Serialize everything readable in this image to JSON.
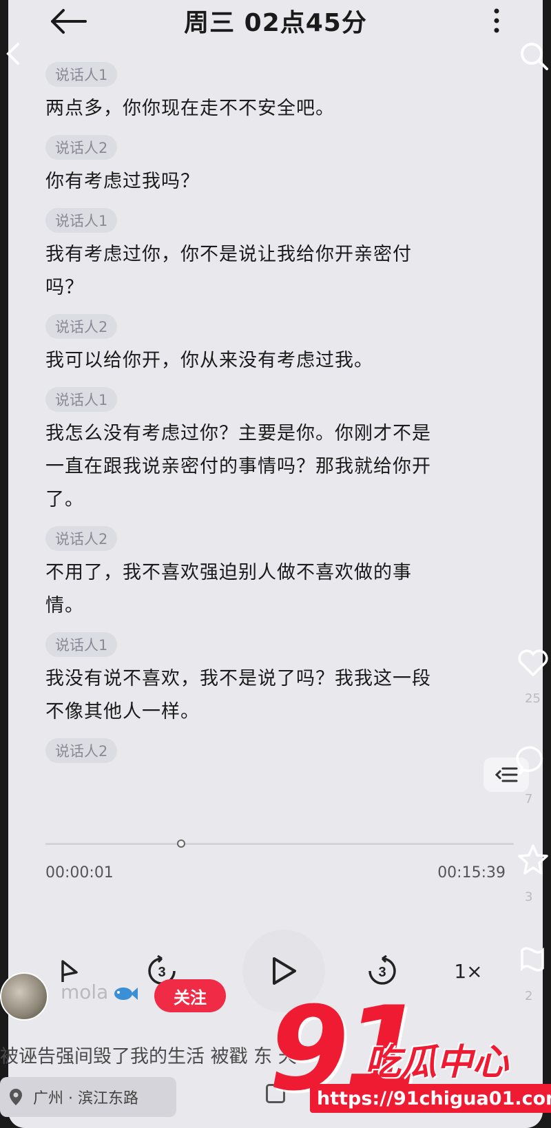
{
  "header": {
    "title": "周三 02点45分"
  },
  "transcript": [
    {
      "speaker": "说话人1",
      "lines": [
        "两点多，你你现在走不不安全吧。"
      ]
    },
    {
      "speaker": "说话人2",
      "lines": [
        "你有考虑过我吗？"
      ]
    },
    {
      "speaker": "说话人1",
      "lines": [
        "我有考虑过你，你不是说让我给你开亲密付",
        "吗？"
      ]
    },
    {
      "speaker": "说话人2",
      "lines": [
        "我可以给你开，你从来没有考虑过我。"
      ]
    },
    {
      "speaker": "说话人1",
      "lines": [
        "我怎么没有考虑过你？主要是你。你刚才不是",
        "一直在跟我说亲密付的事情吗？那我就给你开",
        "了。"
      ]
    },
    {
      "speaker": "说话人2",
      "lines": [
        "不用了，我不喜欢强迫别人做不喜欢做的事",
        "情。"
      ]
    },
    {
      "speaker": "说话人1",
      "lines": [
        "我没有说不喜欢，我不是说了吗？我我这一段",
        "不像其他人一样。"
      ]
    },
    {
      "speaker": "说话人2",
      "lines": []
    }
  ],
  "player": {
    "current_time": "00:00:01",
    "total_time": "00:15:39",
    "progress_fraction": 0.29,
    "speed": "1×",
    "rewind_label": "3",
    "forward_label": "3"
  },
  "rail": {
    "like_count": "25",
    "comment_count": "7",
    "favorite_count": "3",
    "share_count": "2",
    "extra_count": "25"
  },
  "author": {
    "name": "mola",
    "follow_label": "关注"
  },
  "caption": "被诬告强间毁了我的生活 被戳  东  天",
  "location": "广州 · 滨江东路",
  "watermark": {
    "number": "91",
    "brand": "吃瓜中心",
    "url": "https://91chigua01.com"
  },
  "colors": {
    "accent": "#ef2b46",
    "watermark": "#ee1b33",
    "background": "#e9e9ed"
  }
}
